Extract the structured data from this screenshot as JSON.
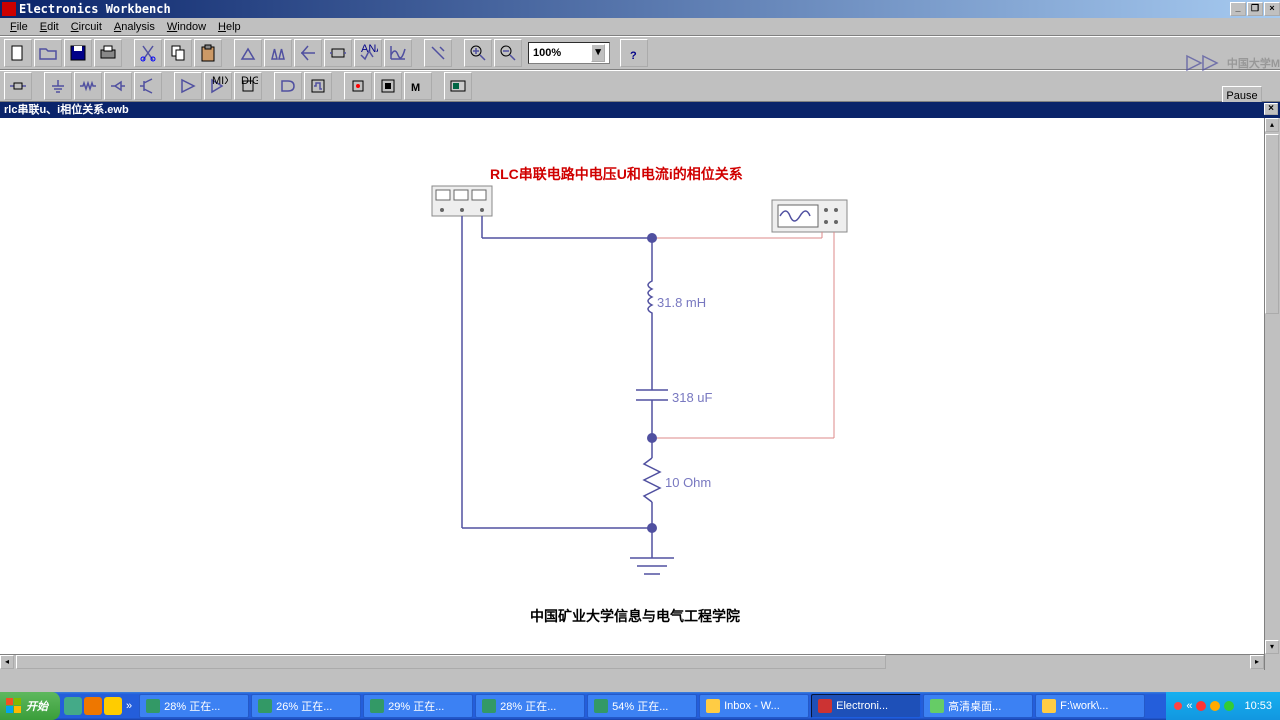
{
  "app": {
    "title": "Electronics Workbench"
  },
  "menu": {
    "file": "File",
    "edit": "Edit",
    "circuit": "Circuit",
    "analysis": "Analysis",
    "window": "Window",
    "help": "Help"
  },
  "toolbar": {
    "zoom": "100%"
  },
  "pause_label": "Pause",
  "document": {
    "title": "rlc串联u、i相位关系.ewb"
  },
  "circuit": {
    "title": "RLC串联电路中电压U和电流i的相位关系",
    "inductor": "31.8 mH",
    "capacitor": "318 uF",
    "resistor": "10  Ohm",
    "footer": "中国矿业大学信息与电气工程学院"
  },
  "watermark": "中国大学M",
  "taskbar": {
    "start": "开始",
    "items": [
      {
        "label": "28% 正在..."
      },
      {
        "label": "26% 正在..."
      },
      {
        "label": "29% 正在..."
      },
      {
        "label": "28% 正在..."
      },
      {
        "label": "54% 正在..."
      },
      {
        "label": "Inbox - W..."
      },
      {
        "label": "Electroni..."
      },
      {
        "label": "高清桌面..."
      },
      {
        "label": "F:\\work\\..."
      }
    ],
    "clock": "10:53"
  }
}
